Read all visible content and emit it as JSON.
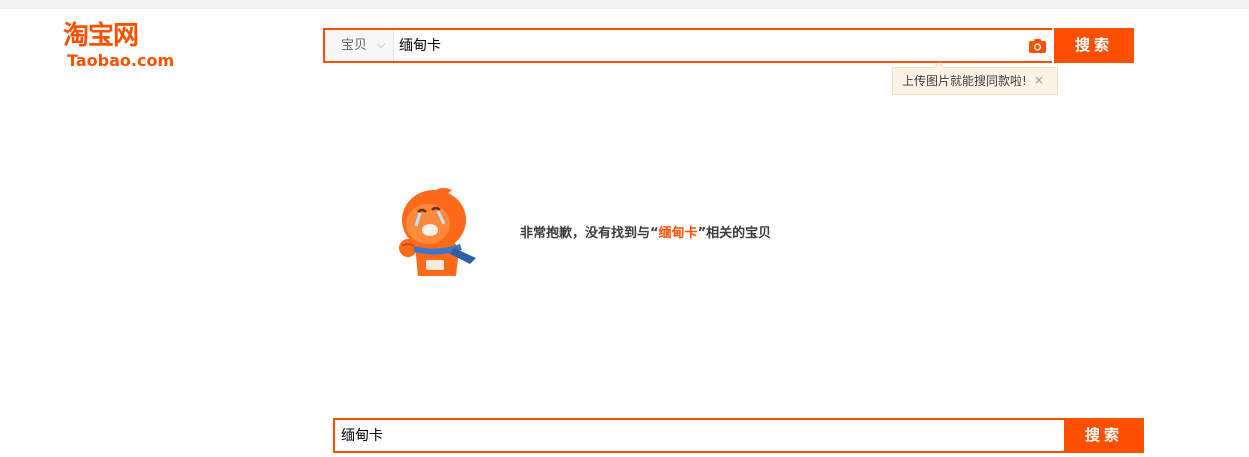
{
  "logo": {
    "cn": "淘宝网",
    "en": "Taobao.com"
  },
  "search_top": {
    "category": "宝贝",
    "query": "缅甸卡",
    "button": "搜索"
  },
  "tooltip": {
    "text": "上传图片就能搜同款啦!",
    "close": "×"
  },
  "no_result": {
    "prefix": "非常抱歉，没有找到与“",
    "keyword": "缅甸卡",
    "suffix": "”相关的宝贝"
  },
  "search_bottom": {
    "query": "缅甸卡",
    "button": "搜索"
  },
  "icons": {
    "camera": "camera-icon",
    "chevron": "chevron-down-icon"
  },
  "colors": {
    "brand": "#ff5000",
    "tooltip_bg": "#fff3e6"
  }
}
